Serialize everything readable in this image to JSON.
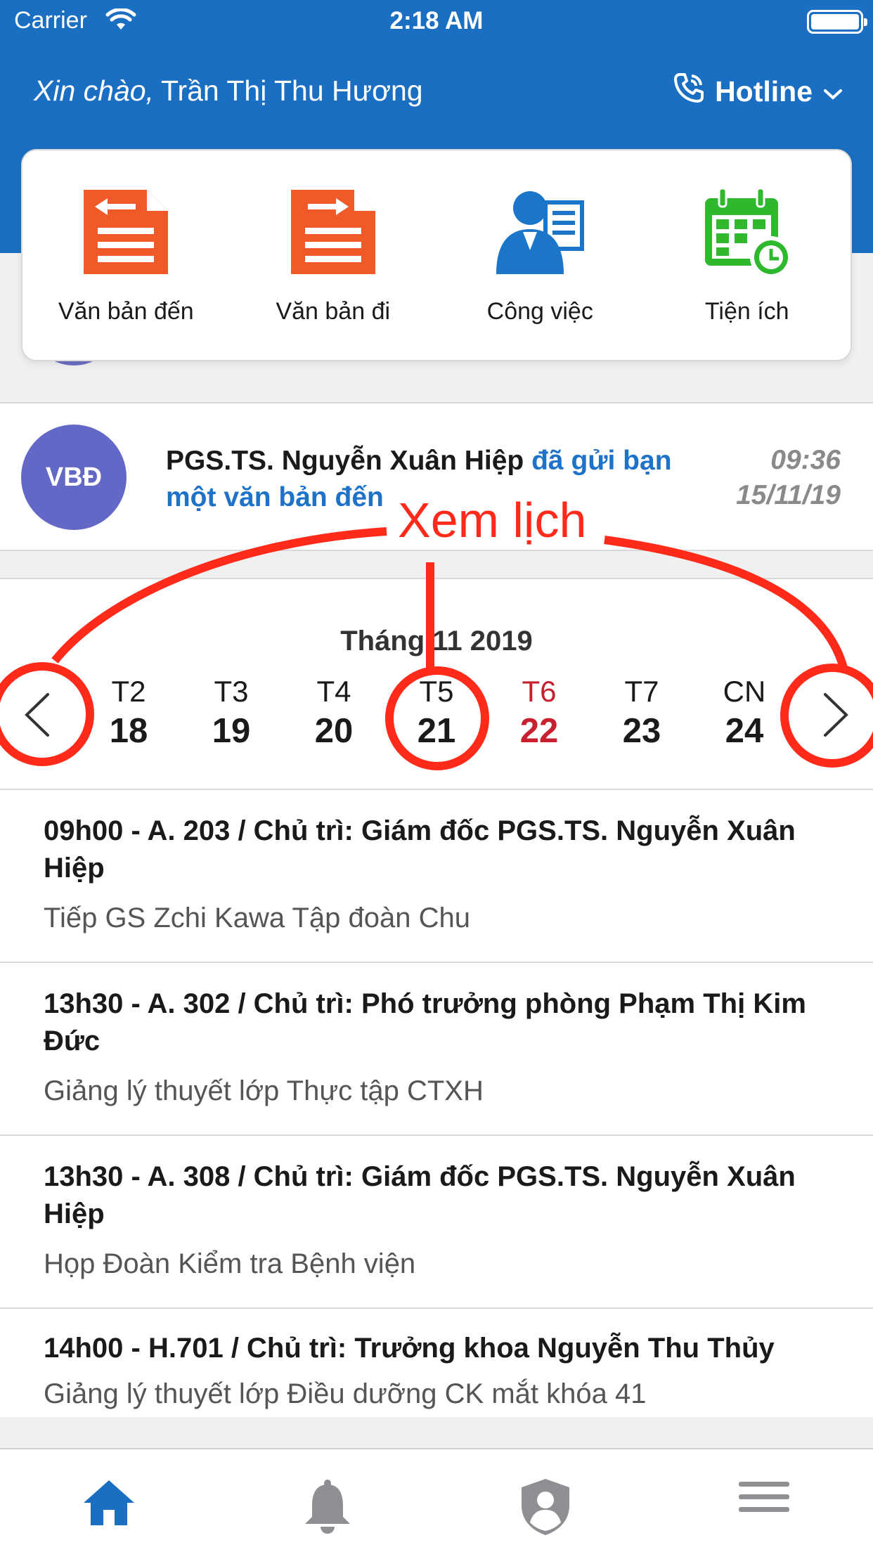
{
  "status_bar": {
    "carrier": "Carrier",
    "time": "2:18 AM"
  },
  "header": {
    "greeting_prefix": "Xin chào,",
    "user_name": "Trần Thị Thu Hương",
    "hotline_label": "Hotline"
  },
  "quick_actions": [
    {
      "label": "Văn bản đến",
      "icon": "incoming-document-icon",
      "color": "#f05a28"
    },
    {
      "label": "Văn bản đi",
      "icon": "outgoing-document-icon",
      "color": "#f05a28"
    },
    {
      "label": "Công việc",
      "icon": "task-user-icon",
      "color": "#1b75c9"
    },
    {
      "label": "Tiện ích",
      "icon": "calendar-clock-icon",
      "color": "#2eb82e"
    }
  ],
  "notification": {
    "avatar_text": "VBĐ",
    "sender": "PGS.TS. Nguyễn Xuân Hiệp",
    "action": "đã gửi bạn một văn bản đến",
    "time": "09:36",
    "date": "15/11/19"
  },
  "calendar": {
    "month_label": "Tháng 11 2019",
    "days": [
      {
        "dow": "T2",
        "date": "18"
      },
      {
        "dow": "T3",
        "date": "19"
      },
      {
        "dow": "T4",
        "date": "20"
      },
      {
        "dow": "T5",
        "date": "21"
      },
      {
        "dow": "T6",
        "date": "22"
      },
      {
        "dow": "T7",
        "date": "23"
      },
      {
        "dow": "CN",
        "date": "24"
      }
    ],
    "highlighted_day": "T6"
  },
  "events": [
    {
      "title": "09h00 - A. 203 / Chủ trì: Giám đốc PGS.TS. Nguyễn Xuân Hiệp",
      "desc": "Tiếp GS Zchi Kawa Tập đoàn Chu"
    },
    {
      "title": "13h30 - A. 302 / Chủ trì: Phó trưởng phòng Phạm Thị Kim Đức",
      "desc": "Giảng lý thuyết lớp Thực tập CTXH"
    },
    {
      "title": "13h30 - A. 308 / Chủ trì: Giám đốc PGS.TS. Nguyễn Xuân Hiệp",
      "desc": "Họp Đoàn Kiểm tra Bệnh viện"
    },
    {
      "title": "14h00 - H.701 / Chủ trì: Trưởng khoa Nguyễn Thu Thủy",
      "desc": "Giảng lý thuyết lớp Điều dưỡng CK mắt khóa 41"
    }
  ],
  "annotation": {
    "label": "Xem lịch",
    "color": "#ff2a1a"
  },
  "tabbar": {
    "items": [
      {
        "icon": "home-icon",
        "active": true
      },
      {
        "icon": "bell-icon",
        "active": false
      },
      {
        "icon": "shield-user-icon",
        "active": false
      },
      {
        "icon": "menu-icon",
        "active": false
      }
    ],
    "active_color": "#1b6fc2",
    "inactive_color": "#8e8e93"
  }
}
